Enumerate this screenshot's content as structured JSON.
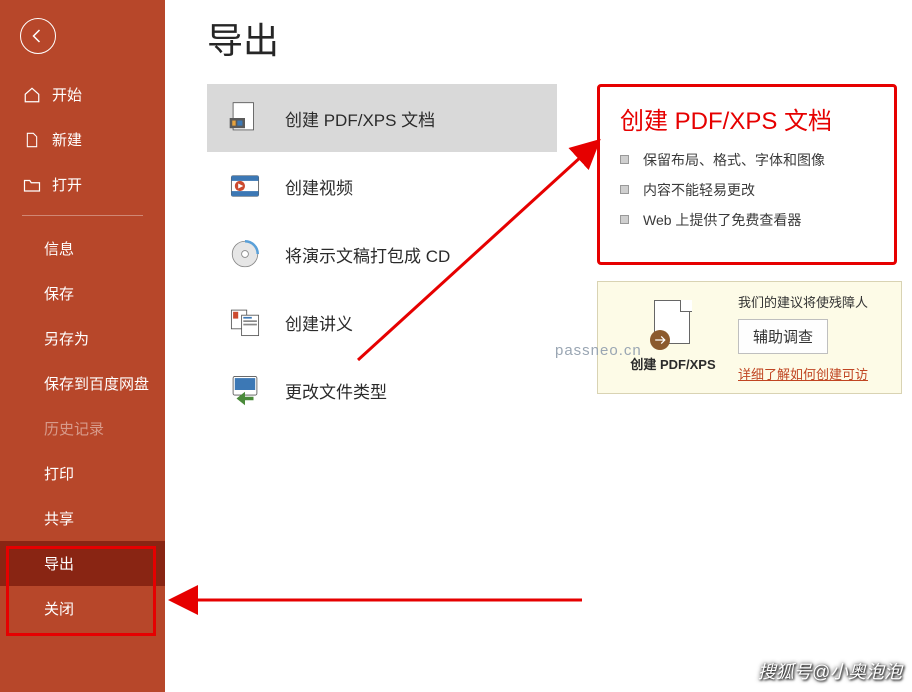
{
  "sidebar": {
    "items": [
      {
        "label": "开始"
      },
      {
        "label": "新建"
      },
      {
        "label": "打开"
      },
      {
        "label": "信息"
      },
      {
        "label": "保存"
      },
      {
        "label": "另存为"
      },
      {
        "label": "保存到百度网盘"
      },
      {
        "label": "历史记录"
      },
      {
        "label": "打印"
      },
      {
        "label": "共享"
      },
      {
        "label": "导出"
      },
      {
        "label": "关闭"
      }
    ]
  },
  "main": {
    "title": "导出",
    "export_options": [
      {
        "label": "创建 PDF/XPS 文档"
      },
      {
        "label": "创建视频"
      },
      {
        "label": "将演示文稿打包成 CD"
      },
      {
        "label": "创建讲义"
      },
      {
        "label": "更改文件类型"
      }
    ]
  },
  "panel": {
    "title": "创建 PDF/XPS 文档",
    "bullets": [
      "保留布局、格式、字体和图像",
      "内容不能轻易更改",
      "Web 上提供了免费查看器"
    ],
    "create_caption": "创建 PDF/XPS",
    "sub_text": "我们的建议将使残障人",
    "help_button": "辅助调查",
    "link": "详细了解如何创建可访"
  },
  "watermarks": {
    "w1": "passneo.cn",
    "w2": "搜狐号@小奥泡泡"
  }
}
